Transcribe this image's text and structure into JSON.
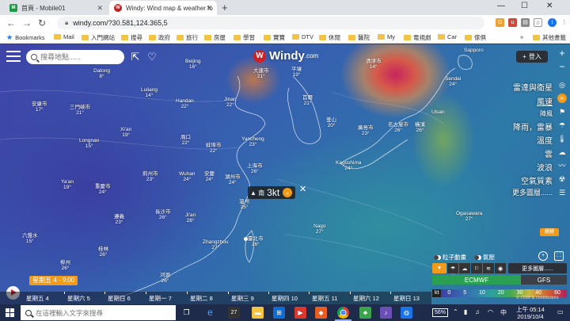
{
  "browser": {
    "tabs": [
      {
        "title": "首頁 - Mobile01",
        "icon": "M"
      },
      {
        "title": "Windy: Wind map & weather fo",
        "icon": "W"
      }
    ],
    "new_tab_label": "+",
    "window_controls": {
      "minimize": "—",
      "maximize": "☐",
      "close": "✕"
    },
    "url": "windy.com/?30.581,124.365,5",
    "bookmarks": [
      "Bookmarks",
      "Mail",
      "入門網站",
      "搜尋",
      "政府",
      "旅行",
      "房屋",
      "學習",
      "寶寶",
      "DTV",
      "休閒",
      "醫院",
      "My",
      "電視劇",
      "Car",
      "傢俱",
      "其他書籤"
    ],
    "bookmarks_more": "»"
  },
  "map": {
    "search": {
      "placeholder": "搜尋地點......"
    },
    "logo": {
      "word": "Windy",
      "suffix": ".com"
    },
    "login_label": "登入",
    "layers": [
      {
        "label": "雷達與衛星",
        "small": false
      },
      {
        "label": "風速",
        "small": false
      },
      {
        "label": "陣風",
        "small": true
      },
      {
        "label": "降雨，雷暴",
        "small": false
      },
      {
        "label": "溫度",
        "small": false
      },
      {
        "label": "雲",
        "small": false
      },
      {
        "label": "波浪",
        "small": false
      },
      {
        "label": "空氣質素",
        "small": false
      }
    ],
    "more_layers_label": "更多圖層......",
    "popup": {
      "direction": "▲ 南",
      "value": "3kt"
    },
    "orange_tag": "醒醒",
    "toggles": [
      "粒子動畫",
      "氣壓"
    ],
    "overlay_more": "更多圖層......",
    "models": [
      "ECMWF",
      "GFS"
    ],
    "scale": {
      "unit": "kt",
      "stops": [
        "0",
        "5",
        "10",
        "20",
        "30",
        "40",
        "60"
      ]
    },
    "time_bubble": "星期五 4 - 9:00",
    "days": [
      "星期五 4",
      "星期六 5",
      "星期日 6",
      "星期一 7",
      "星期二 8",
      "星期三 9",
      "星期四 10",
      "星期五 11",
      "星期六 12",
      "星期日 13"
    ],
    "attribution": "© OSM & contributors",
    "cities": [
      {
        "name": "Datong",
        "temp": "8°"
      },
      {
        "name": "Beijing",
        "temp": "16°"
      },
      {
        "name": "Luliang",
        "temp": "14°"
      },
      {
        "name": "Handan",
        "temp": "22°"
      },
      {
        "name": "Jinan",
        "temp": "22°"
      },
      {
        "name": "三門峽市",
        "temp": "21°"
      },
      {
        "name": "安康市",
        "temp": "17°"
      },
      {
        "name": "Longnan",
        "temp": "15°"
      },
      {
        "name": "Xi'an",
        "temp": "19°"
      },
      {
        "name": "周口",
        "temp": "22°"
      },
      {
        "name": "蚌埠市",
        "temp": "22°"
      },
      {
        "name": "Yancheng",
        "temp": "23°"
      },
      {
        "name": "Ya'an",
        "temp": "19°"
      },
      {
        "name": "重慶市",
        "temp": "24°"
      },
      {
        "name": "荊州市",
        "temp": "23°"
      },
      {
        "name": "Wuhan",
        "temp": "24°"
      },
      {
        "name": "安慶",
        "temp": "24°"
      },
      {
        "name": "湖州市",
        "temp": "24°"
      },
      {
        "name": "上海市",
        "temp": "26°"
      },
      {
        "name": "遵義",
        "temp": "23°"
      },
      {
        "name": "長沙市",
        "temp": "26°"
      },
      {
        "name": "Ji'an",
        "temp": "28°"
      },
      {
        "name": "溫州",
        "temp": "25°"
      },
      {
        "name": "六盤水",
        "temp": "15°"
      },
      {
        "name": "桂林",
        "temp": "26°"
      },
      {
        "name": "Zhangzhou",
        "temp": "27°"
      },
      {
        "name": "臺北市",
        "temp": "26°"
      },
      {
        "name": "柳州",
        "temp": "26°"
      },
      {
        "name": "河源",
        "temp": "26°"
      },
      {
        "name": "平壤",
        "temp": "19°"
      },
      {
        "name": "首爾",
        "temp": "21°"
      },
      {
        "name": "大連市",
        "temp": "21°"
      },
      {
        "name": "釜山",
        "temp": "20°"
      },
      {
        "name": "Kagoshima",
        "temp": "24°"
      },
      {
        "name": "廣島市",
        "temp": "23°"
      },
      {
        "name": "名古屋市",
        "temp": "26°"
      },
      {
        "name": "橫濱",
        "temp": "26°"
      },
      {
        "name": "Sendai",
        "temp": "24°"
      },
      {
        "name": "Ogasawara",
        "temp": "27°"
      },
      {
        "name": "Nago",
        "temp": "27°"
      },
      {
        "name": "清津市",
        "temp": "14°"
      },
      {
        "name": "Sapporo",
        "temp": ""
      },
      {
        "name": "Ulsan",
        "temp": ""
      }
    ]
  },
  "taskbar": {
    "search_placeholder": "在這裡輸入文字來搜尋",
    "battery": "56%",
    "ime": "中",
    "clock_time": "上午 05:14",
    "clock_date": "2019/10/4",
    "notif_badge": "27"
  }
}
